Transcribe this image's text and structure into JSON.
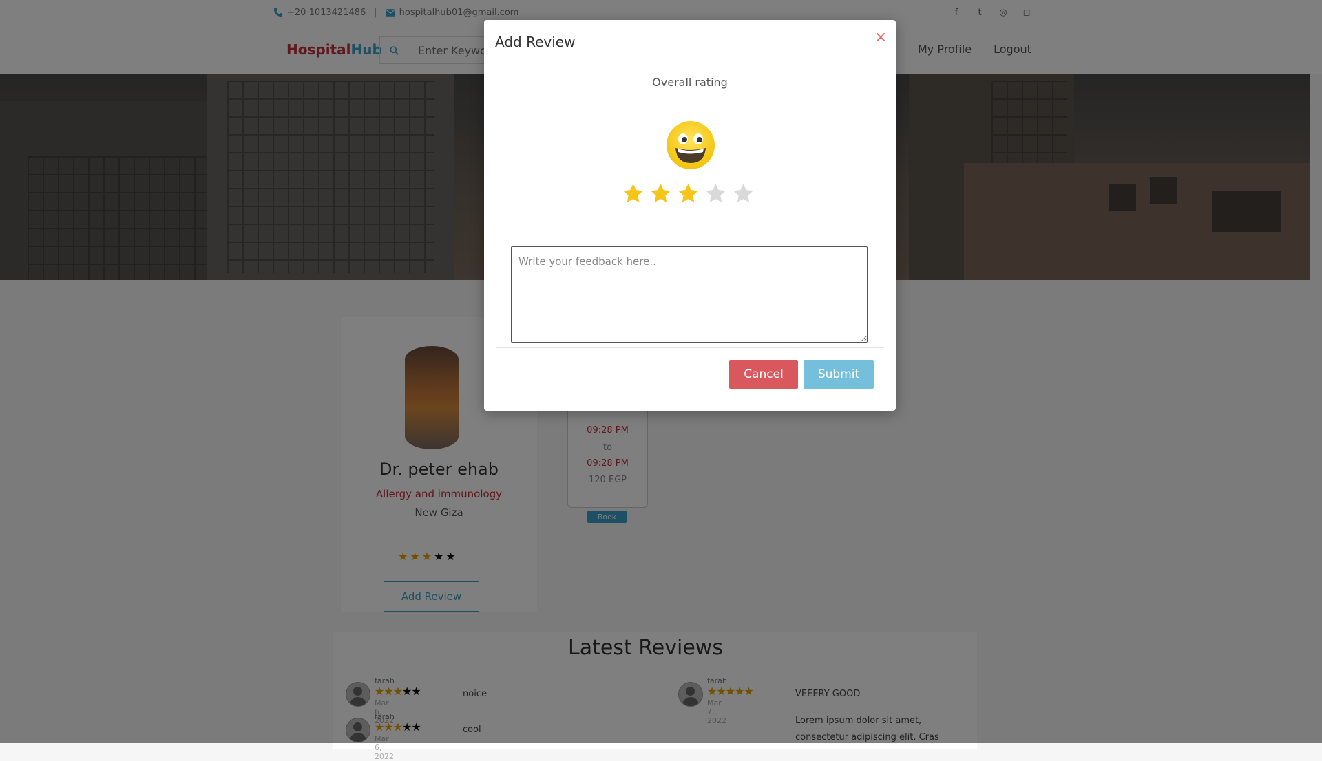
{
  "topbar": {
    "phone": "+20 1013421486",
    "separator": "|",
    "email": "hospitalhub01@gmail.com",
    "social_icons": [
      "facebook-icon",
      "twitter-icon",
      "dribbble-icon",
      "instagram-icon"
    ],
    "social_glyphs": [
      "f",
      "t",
      "◎",
      "◻"
    ]
  },
  "navbar": {
    "logo_part1": "Hospital",
    "logo_part2": "Hub",
    "search_placeholder": "Enter Keyword",
    "links": [
      "My Profile",
      "Logout"
    ]
  },
  "colors": {
    "brand_red": "#c0313b",
    "brand_blue": "#3aa0c9",
    "star_gold": "#f5c518",
    "star_empty": "#d9d9d9",
    "cancel": "#d9585e",
    "submit": "#74c0dc"
  },
  "doctor": {
    "name": "Dr. peter ehab",
    "specialty": "Allergy and immunology",
    "location": "New Giza",
    "rating": 3,
    "rating_max": 5,
    "add_review_label": "Add Review"
  },
  "schedule": {
    "from": "09:28 PM",
    "to_label": "to",
    "to": "09:28 PM",
    "price": "120 EGP",
    "book_label": "Book"
  },
  "reviews": {
    "title": "Latest Reviews",
    "items": [
      {
        "name": "farah",
        "rating": 3,
        "date": "Mar 6, 2022",
        "comment": "noice"
      },
      {
        "name": "farah",
        "rating": 3,
        "date": "Mar 6, 2022",
        "comment": "cool"
      },
      {
        "name": "farah",
        "rating": 5,
        "date": "Mar 7, 2022",
        "comment": "VEEERY GOOD"
      }
    ],
    "lorem": "Lorem ipsum dolor sit amet, consectetur adipiscing elit. Cras"
  },
  "modal": {
    "title": "Add Review",
    "close": "×",
    "overall_label": "Overall rating",
    "emoji": "grinning-face-icon",
    "rating": 3,
    "rating_max": 5,
    "feedback_placeholder": "Write your feedback here..",
    "cancel_label": "Cancel",
    "submit_label": "Submit"
  }
}
